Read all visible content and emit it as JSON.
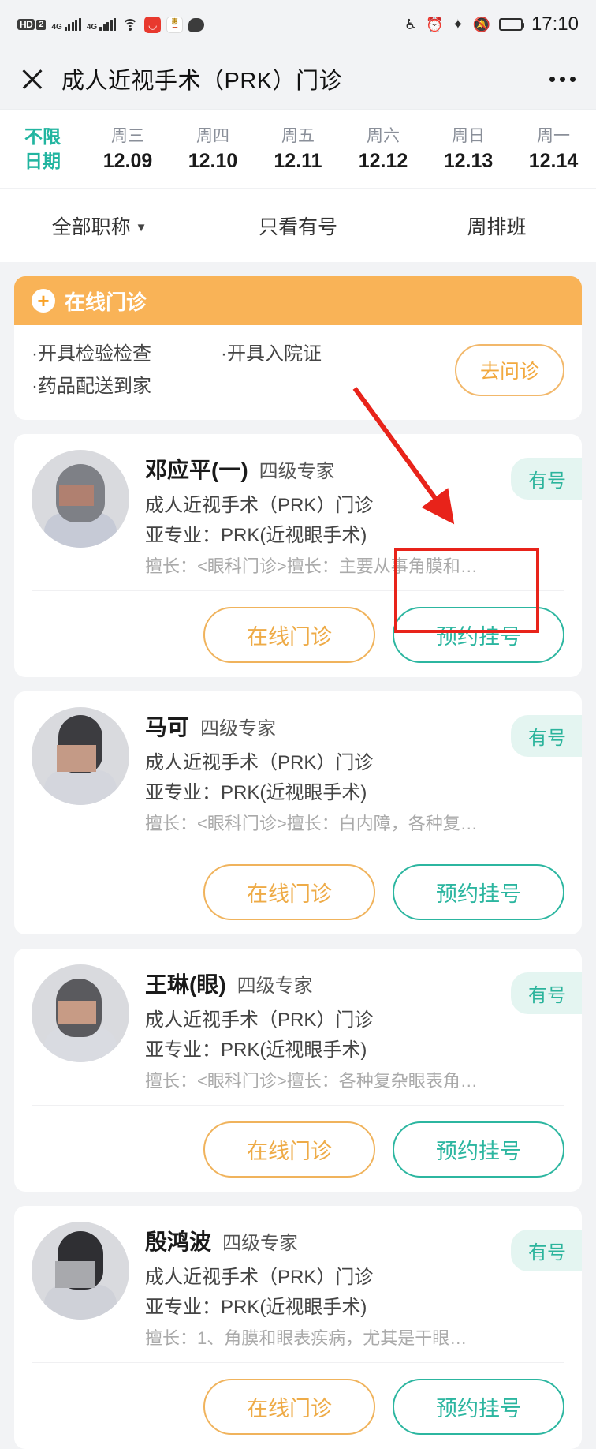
{
  "statusbar": {
    "network_tag": "HD",
    "network_num": "2",
    "sim1_gen": "4G",
    "sim2_gen": "4G",
    "icons": [
      "hd-icon",
      "signal-bars-icon",
      "wifi-icon",
      "huawei-app-icon",
      "coupon-app-icon",
      "chat-bubble-icon",
      "headphone-icon",
      "alarm-icon",
      "bluetooth-icon",
      "mute-icon",
      "battery-icon"
    ],
    "headphone": "Ἲ7",
    "time": "17:10"
  },
  "titlebar": {
    "close_label": "✕",
    "title": "成人近视手术（PRK）门诊",
    "more_label": "⋯"
  },
  "dates": [
    {
      "week": "不限",
      "day": "日期",
      "selected": true
    },
    {
      "week": "周三",
      "day": "12.09",
      "selected": false
    },
    {
      "week": "周四",
      "day": "12.10",
      "selected": false
    },
    {
      "week": "周五",
      "day": "12.11",
      "selected": false
    },
    {
      "week": "周六",
      "day": "12.12",
      "selected": false
    },
    {
      "week": "周日",
      "day": "12.13",
      "selected": false
    },
    {
      "week": "周一",
      "day": "12.14",
      "selected": false
    }
  ],
  "filters": [
    {
      "label": "全部职称",
      "caret": "▼"
    },
    {
      "label": "只看有号",
      "caret": ""
    },
    {
      "label": "周排班",
      "caret": ""
    }
  ],
  "promo": {
    "header_title": "在线门诊",
    "header_icon": "medical-cross-icon",
    "items": [
      "·开具检验检查",
      "·开具入院证",
      "·药品配送到家"
    ],
    "button": "去问诊",
    "accent": "#f9b357"
  },
  "doctors": [
    {
      "name": "邓应平(一)",
      "title": "四级专家",
      "clinic": "成人近视手术（PRK）门诊",
      "subspecialty": "亚专业：PRK(近视眼手术)",
      "expertise": "擅长：<眼科门诊>擅长：主要从事角膜和…",
      "badge": "有号",
      "btn_online": "在线门诊",
      "btn_book": "预约挂号",
      "highlighted": true
    },
    {
      "name": "马可",
      "title": "四级专家",
      "clinic": "成人近视手术（PRK）门诊",
      "subspecialty": "亚专业：PRK(近视眼手术)",
      "expertise": "擅长：<眼科门诊>擅长：白内障，各种复…",
      "badge": "有号",
      "btn_online": "在线门诊",
      "btn_book": "预约挂号",
      "highlighted": false
    },
    {
      "name": "王琳(眼)",
      "title": "四级专家",
      "clinic": "成人近视手术（PRK）门诊",
      "subspecialty": "亚专业：PRK(近视眼手术)",
      "expertise": "擅长：<眼科门诊>擅长：各种复杂眼表角…",
      "badge": "有号",
      "btn_online": "在线门诊",
      "btn_book": "预约挂号",
      "highlighted": false
    },
    {
      "name": "殷鸿波",
      "title": "四级专家",
      "clinic": "成人近视手术（PRK）门诊",
      "subspecialty": "亚专业：PRK(近视眼手术)",
      "expertise": "擅长：1、角膜和眼表疾病，尤其是干眼…",
      "badge": "有号",
      "btn_online": "在线门诊",
      "btn_book": "预约挂号",
      "highlighted": false
    }
  ],
  "annotations": {
    "arrow_color": "#e8231a",
    "rect_color": "#e8231a"
  }
}
